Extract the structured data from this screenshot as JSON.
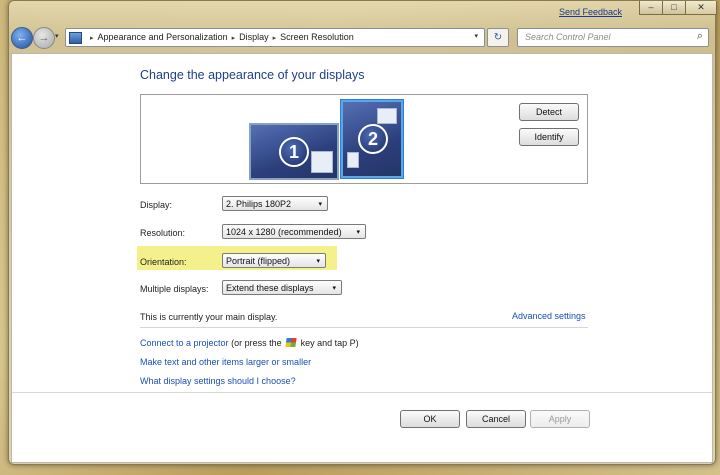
{
  "titlebar": {
    "feedback": "Send Feedback",
    "minimize": "‒",
    "maximize": "□",
    "close": "✕"
  },
  "address": {
    "crumbs": [
      "Appearance and Personalization",
      "Display",
      "Screen Resolution"
    ],
    "back_icon": "←",
    "forward_icon": "→",
    "dropdown_icon": "▾",
    "refresh_icon": "↻",
    "search_placeholder": "Search Control Panel",
    "search_icon": "⌕"
  },
  "main": {
    "title": "Change the appearance of your displays",
    "monitors": [
      {
        "number": "1"
      },
      {
        "number": "2"
      }
    ],
    "detect_label": "Detect",
    "identify_label": "Identify",
    "display_label": "Display:",
    "display_value": "2. Philips 180P2",
    "resolution_label": "Resolution:",
    "resolution_value": "1024 x 1280 (recommended)",
    "orientation_label": "Orientation:",
    "orientation_value": "Portrait (flipped)",
    "multiple_label": "Multiple displays:",
    "multiple_value": "Extend these displays",
    "main_display_text": "This is currently your main display.",
    "advanced_link": "Advanced settings",
    "projector_link": "Connect to a projector",
    "projector_text_a": "(or press the",
    "projector_text_b": "key and tap P)",
    "larger_link": "Make text and other items larger or smaller",
    "which_link": "What display settings should I choose?"
  },
  "footer": {
    "ok": "OK",
    "cancel": "Cancel",
    "apply": "Apply"
  },
  "colors": {
    "highlight": "#f4f18c",
    "link": "#1b4fb5",
    "title": "#1e3f8c"
  }
}
